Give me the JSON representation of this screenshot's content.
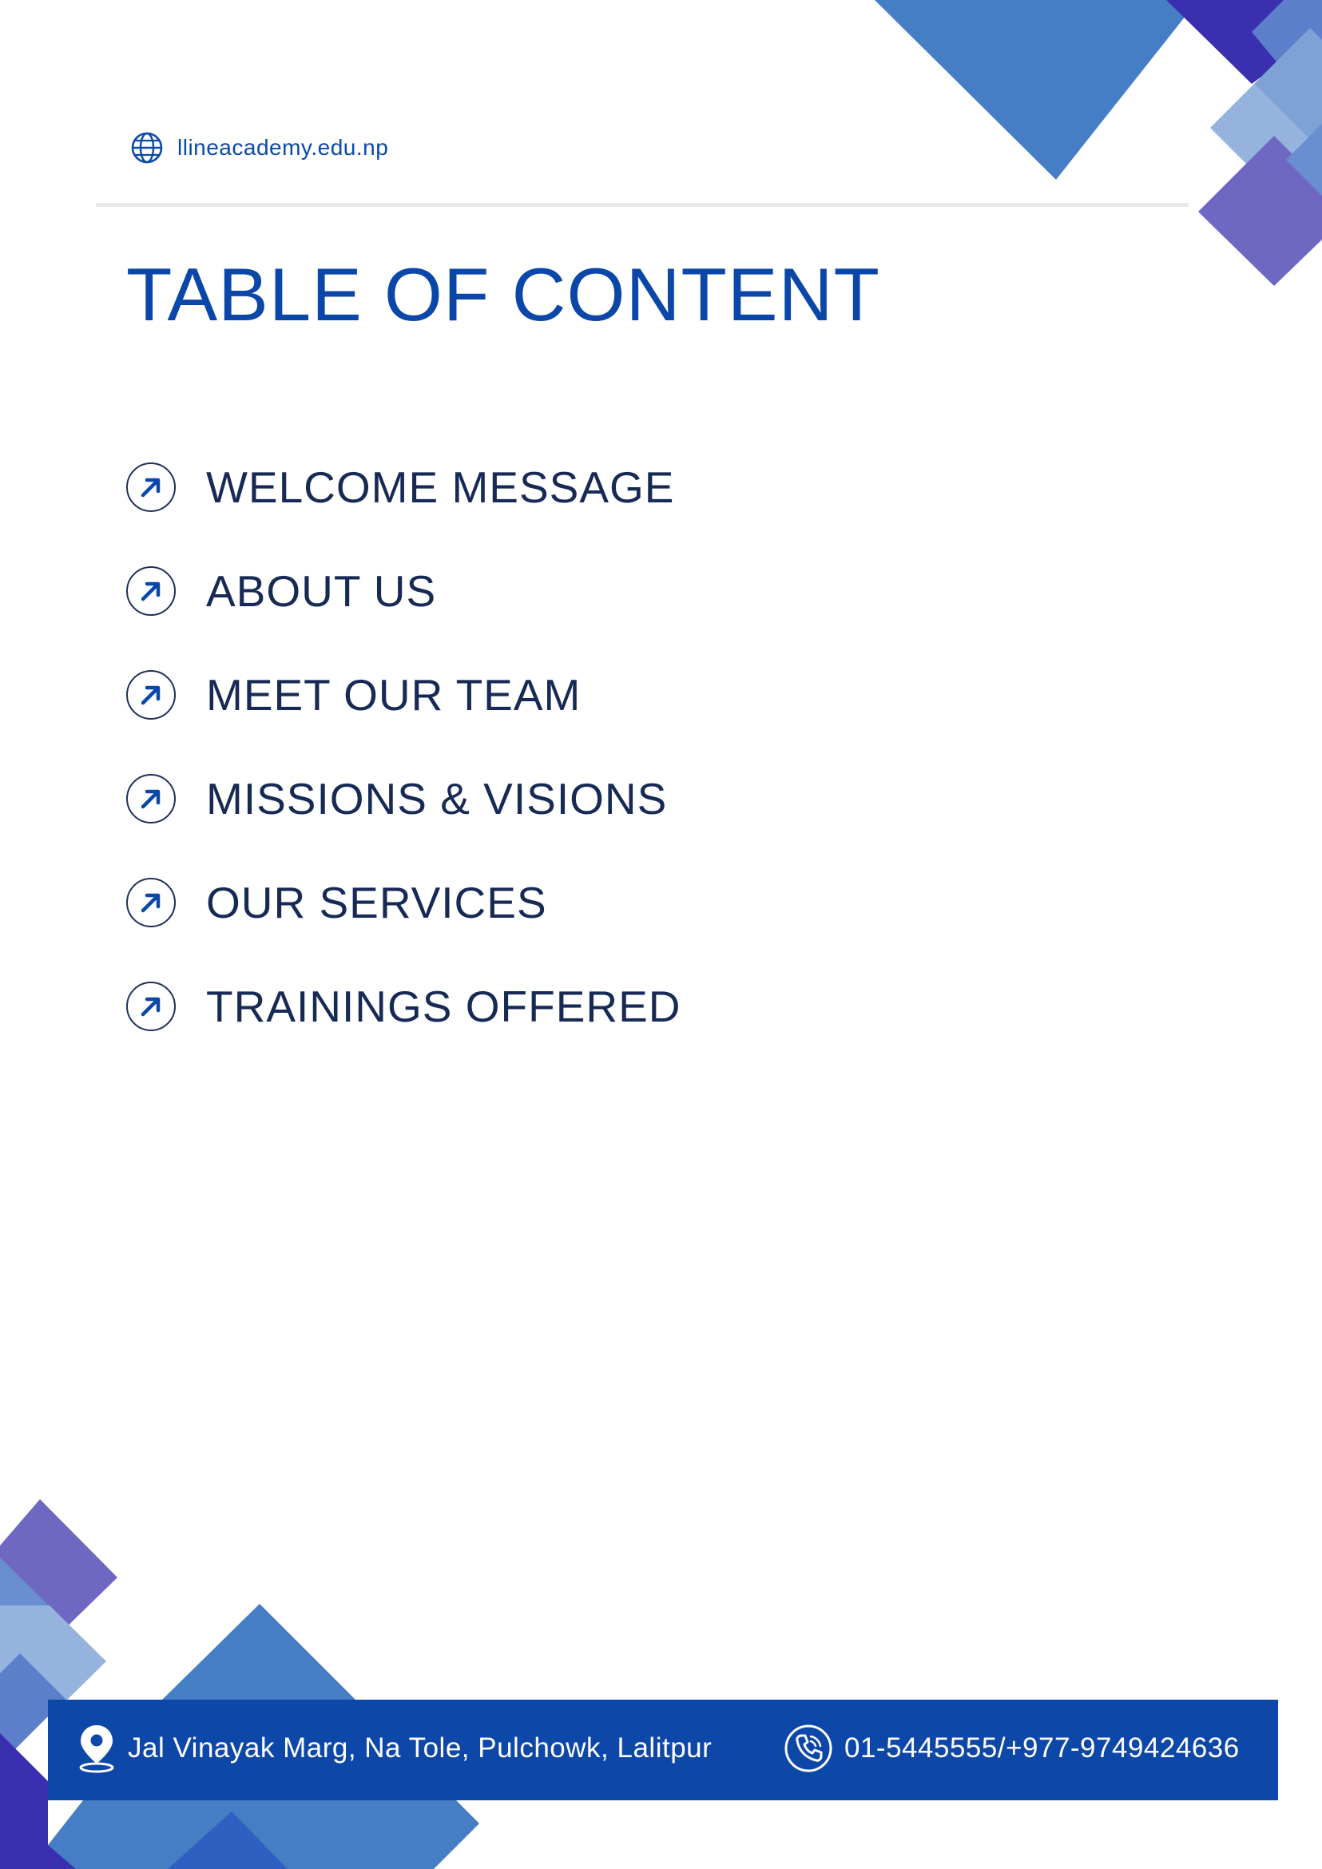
{
  "header": {
    "website": "llineacademy.edu.np",
    "globe_icon": "globe-icon"
  },
  "title": "TABLE OF CONTENT",
  "toc": {
    "item_icon": "arrow-up-right-circle-icon",
    "items": [
      {
        "label": "WELCOME MESSAGE"
      },
      {
        "label": "ABOUT US"
      },
      {
        "label": "MEET OUR TEAM"
      },
      {
        "label": "MISSIONS & VISIONS"
      },
      {
        "label": "OUR SERVICES"
      },
      {
        "label": "TRAININGS OFFERED"
      }
    ]
  },
  "footer": {
    "address": "Jal Vinayak Marg, Na Tole, Pulchowk, Lalitpur",
    "address_icon": "location-pin-icon",
    "phone": "01-5445555/+977-9749424636",
    "phone_icon": "phone-icon"
  },
  "colors": {
    "primary_blue": "#0b47a9",
    "text_navy": "#172a55",
    "footer_bar": "#0d47a8",
    "deco_mid_blue": "#457ec4",
    "deco_indigo": "#3a2fae",
    "deco_violet": "#6e68c3",
    "deco_light_blue": "#95b3dd"
  }
}
